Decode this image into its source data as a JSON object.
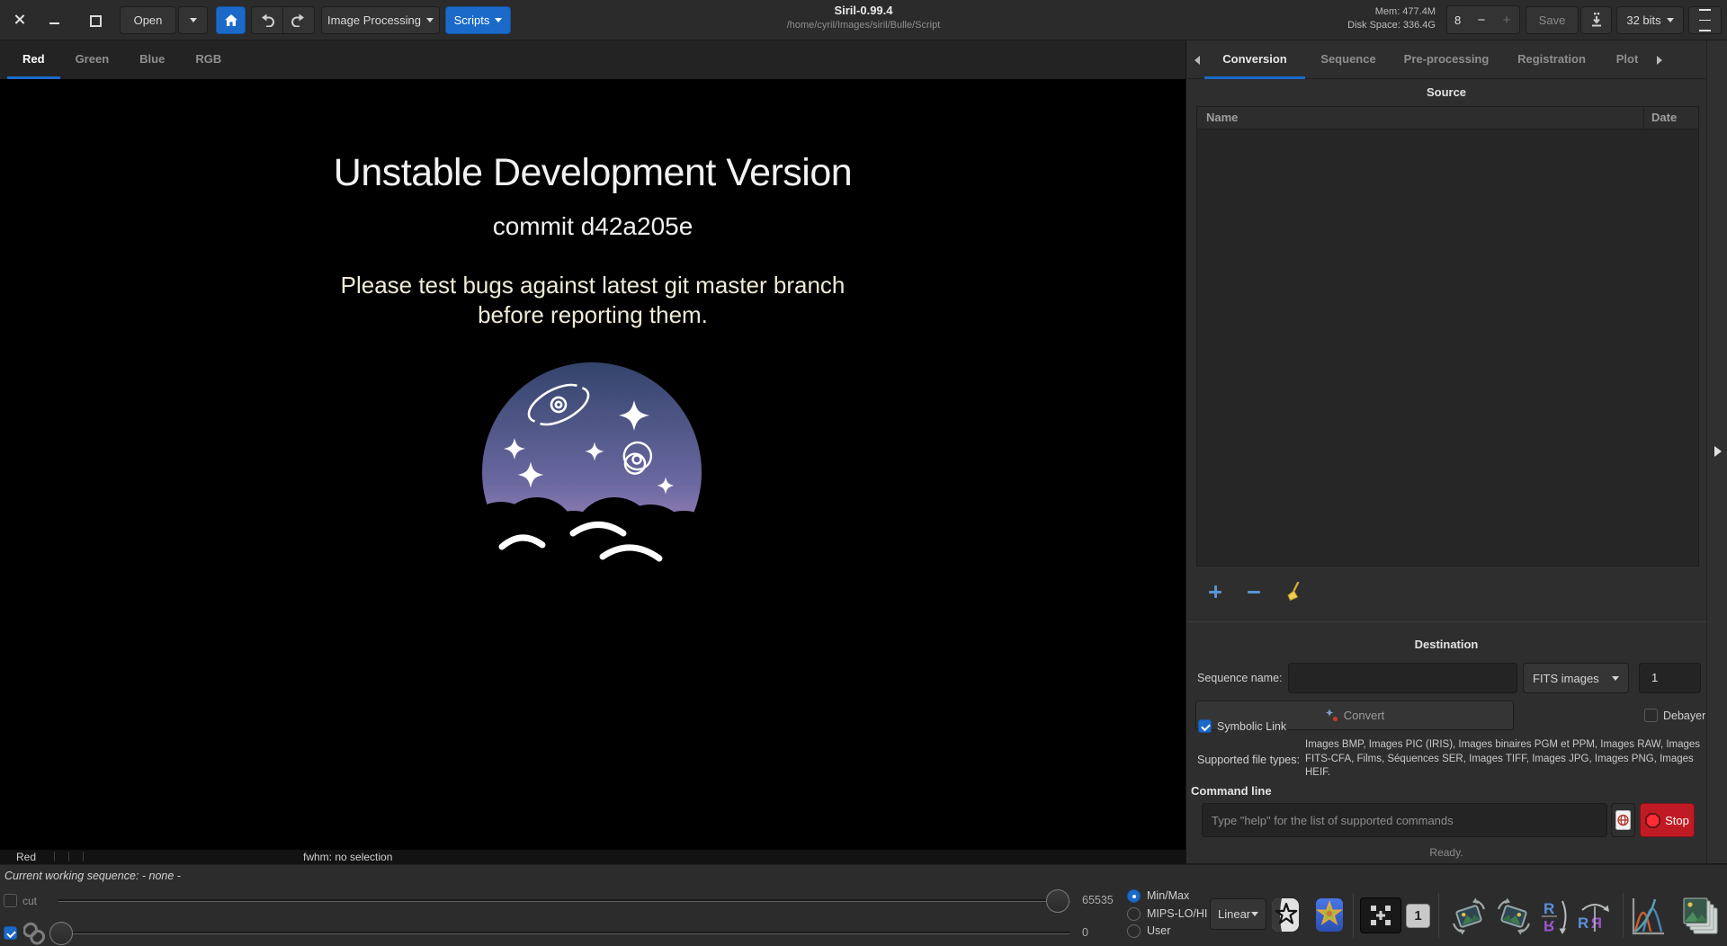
{
  "titlebar": {
    "title": "Siril-0.99.4",
    "path": "/home/cyril/Images/siril/Bulle/Script",
    "open": "Open",
    "image_processing": "Image Processing",
    "scripts": "Scripts",
    "mem": "Mem: 477.4M",
    "disk": "Disk Space: 336.4G",
    "zoom_level": "8",
    "save": "Save",
    "bit_depth": "32 bits"
  },
  "image_tabs": [
    {
      "label": "Red",
      "active": true
    },
    {
      "label": "Green",
      "active": false
    },
    {
      "label": "Blue",
      "active": false
    },
    {
      "label": "RGB",
      "active": false
    }
  ],
  "canvas": {
    "title": "Unstable Development Version",
    "commit": "commit d42a205e",
    "message_line1": "Please test bugs against latest git master branch",
    "message_line2": "before reporting them."
  },
  "status_bar": {
    "channel": "Red",
    "fwhm": "fwhm: no selection"
  },
  "right_panel": {
    "tabs": [
      {
        "label": "Conversion",
        "active": true
      },
      {
        "label": "Sequence",
        "active": false
      },
      {
        "label": "Pre-processing",
        "active": false
      },
      {
        "label": "Registration",
        "active": false
      },
      {
        "label": "Plot",
        "active": false
      }
    ],
    "source": {
      "title": "Source",
      "col_name": "Name",
      "col_date": "Date"
    },
    "destination": {
      "title": "Destination",
      "sequence_name_label": "Sequence name:",
      "format": "FITS images",
      "index": "1",
      "convert": "Convert",
      "debayer": "Debayer",
      "symbolic_link": "Symbolic Link",
      "supported_label": "Supported file types:",
      "supported_types": "Images BMP, Images PIC (IRIS), Images binaires PGM et PPM, Images RAW, Images FITS-CFA, Films, Séquences SER, Images TIFF, Images JPG, Images PNG, Images HEIF."
    },
    "command_line": {
      "title": "Command line",
      "placeholder": "Type \"help\" for the list of supported commands",
      "stop": "Stop",
      "status": "Ready."
    }
  },
  "bottom_bar": {
    "working_sequence_label": "Current working sequence:",
    "working_sequence_value": "- none -",
    "cut": "cut",
    "hi": "65535",
    "lo": "0",
    "modes": [
      {
        "label": "Min/Max",
        "selected": true
      },
      {
        "label": "MIPS-LO/HI",
        "selected": false
      },
      {
        "label": "User",
        "selected": false
      }
    ],
    "stretch": "Linear",
    "zoom_one": "1"
  },
  "colors": {
    "accent": "#1b6ac9",
    "stop_red": "#c01b24",
    "canvas_bg": "#000000"
  }
}
